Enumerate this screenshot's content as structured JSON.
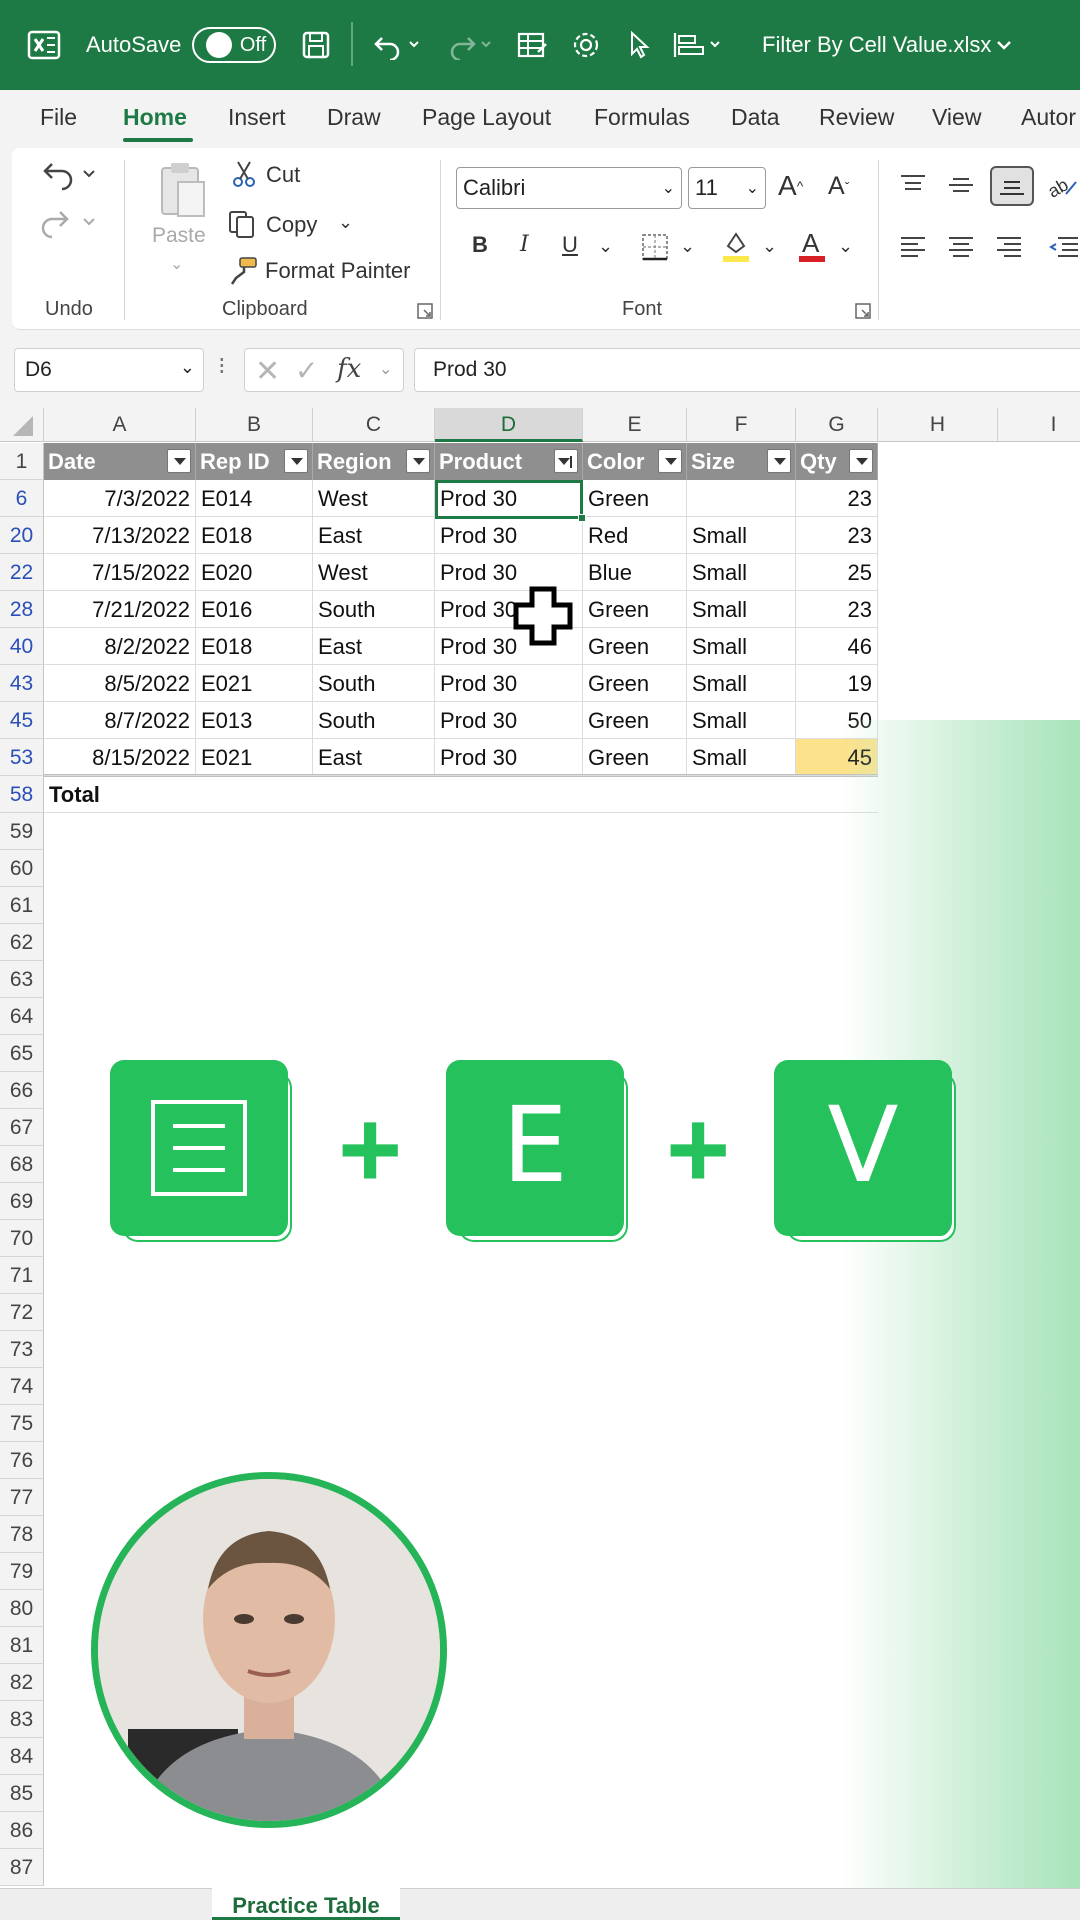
{
  "titlebar": {
    "autosave_label": "AutoSave",
    "autosave_state": "Off",
    "file_title": "Filter By Cell Value.xlsx"
  },
  "menu": {
    "tabs": [
      "File",
      "Home",
      "Insert",
      "Draw",
      "Page Layout",
      "Formulas",
      "Data",
      "Review",
      "View",
      "Autor"
    ],
    "active": "Home"
  },
  "ribbon": {
    "clipboard": {
      "paste": "Paste",
      "cut": "Cut",
      "copy": "Copy",
      "format_painter": "Format Painter"
    },
    "font": {
      "family": "Calibri",
      "size": "11",
      "bold": "B",
      "italic": "I",
      "underline": "U"
    },
    "groups": {
      "undo": "Undo",
      "clipboard": "Clipboard",
      "font": "Font"
    }
  },
  "formula_bar": {
    "name_box": "D6",
    "fx": "fx",
    "formula": "Prod 30"
  },
  "grid": {
    "columns": [
      "A",
      "B",
      "C",
      "D",
      "E",
      "F",
      "G",
      "H",
      "I"
    ],
    "selected_column": "D",
    "header_row_number": "1",
    "headers": [
      "Date",
      "Rep ID",
      "Region",
      "Product",
      "Color",
      "Size",
      "Qty"
    ],
    "filtered_column": "Product",
    "rows": [
      {
        "row": "6",
        "date": "7/3/2022",
        "rep": "E014",
        "region": "West",
        "product": "Prod 30",
        "color": "Green",
        "size": "",
        "qty": "23"
      },
      {
        "row": "20",
        "date": "7/13/2022",
        "rep": "E018",
        "region": "East",
        "product": "Prod 30",
        "color": "Red",
        "size": "Small",
        "qty": "23"
      },
      {
        "row": "22",
        "date": "7/15/2022",
        "rep": "E020",
        "region": "West",
        "product": "Prod 30",
        "color": "Blue",
        "size": "Small",
        "qty": "25"
      },
      {
        "row": "28",
        "date": "7/21/2022",
        "rep": "E016",
        "region": "South",
        "product": "Prod 30",
        "color": "Green",
        "size": "Small",
        "qty": "23"
      },
      {
        "row": "40",
        "date": "8/2/2022",
        "rep": "E018",
        "region": "East",
        "product": "Prod 30",
        "color": "Green",
        "size": "Small",
        "qty": "46"
      },
      {
        "row": "43",
        "date": "8/5/2022",
        "rep": "E021",
        "region": "South",
        "product": "Prod 30",
        "color": "Green",
        "size": "Small",
        "qty": "19"
      },
      {
        "row": "45",
        "date": "8/7/2022",
        "rep": "E013",
        "region": "South",
        "product": "Prod 30",
        "color": "Green",
        "size": "Small",
        "qty": "50"
      },
      {
        "row": "53",
        "date": "8/15/2022",
        "rep": "E021",
        "region": "East",
        "product": "Prod 30",
        "color": "Green",
        "size": "Small",
        "qty": "45"
      }
    ],
    "total_row": {
      "row": "58",
      "label": "Total"
    },
    "empty_rows": [
      "59",
      "60",
      "61",
      "62",
      "63",
      "64",
      "65",
      "66",
      "67",
      "68",
      "69",
      "70",
      "71",
      "72",
      "73",
      "74",
      "75",
      "76",
      "77",
      "78",
      "79",
      "80",
      "81",
      "82",
      "83",
      "84",
      "85",
      "86",
      "87"
    ]
  },
  "shortcut": {
    "keys": [
      "",
      "E",
      "V"
    ],
    "first_key_icon": "menu-key-icon",
    "separator": "+"
  },
  "sheet_tabs": {
    "active": "Practice Table"
  },
  "colors": {
    "excel_green": "#1e7a44",
    "key_green": "#25c15c",
    "table_header_grey": "#8f8f8f",
    "highlight_yellow": "#fce28a"
  }
}
